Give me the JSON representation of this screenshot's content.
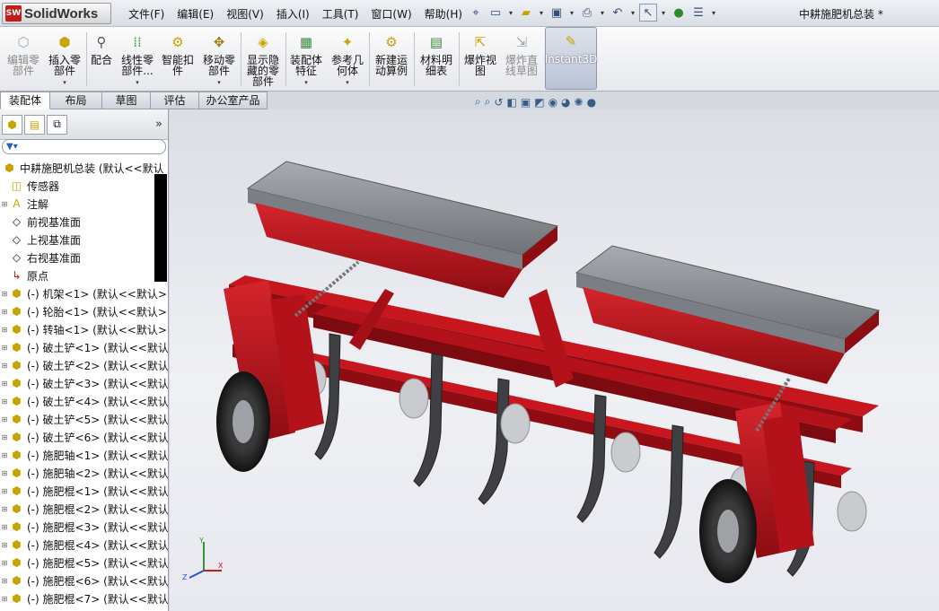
{
  "app": {
    "name": "SolidWorks",
    "logo_mark": "SW"
  },
  "menu": [
    "文件(F)",
    "编辑(E)",
    "视图(V)",
    "插入(I)",
    "工具(T)",
    "窗口(W)",
    "帮助(H)"
  ],
  "quick_toolbar": [
    "pin-icon",
    "new-doc-icon",
    "open-icon",
    "save-icon",
    "print-icon",
    "undo-icon",
    "select-icon",
    "rebuild-icon",
    "options-icon"
  ],
  "document_title": "中耕施肥机总装 *",
  "command_manager": {
    "buttons": [
      {
        "label": "编辑零\n部件",
        "icon": "edit-component-icon",
        "disabled": true
      },
      {
        "label": "插入零\n部件",
        "icon": "insert-component-icon",
        "disabled": false
      },
      {
        "label": "配合",
        "icon": "mate-icon",
        "disabled": false
      },
      {
        "label": "线性零\n部件...",
        "icon": "linear-pattern-icon",
        "disabled": false
      },
      {
        "label": "智能扣\n件",
        "icon": "smart-fastener-icon",
        "disabled": false
      },
      {
        "label": "移动零\n部件",
        "icon": "move-component-icon",
        "disabled": false
      },
      {
        "label": "显示隐\n藏的零\n部件",
        "icon": "show-hidden-icon",
        "disabled": false
      },
      {
        "label": "装配体\n特征",
        "icon": "assembly-feature-icon",
        "disabled": false
      },
      {
        "label": "参考几\n何体",
        "icon": "reference-geometry-icon",
        "disabled": false
      },
      {
        "label": "新建运\n动算例",
        "icon": "motion-study-icon",
        "disabled": false
      },
      {
        "label": "材料明\n细表",
        "icon": "bom-icon",
        "disabled": false
      },
      {
        "label": "爆炸视\n图",
        "icon": "exploded-view-icon",
        "disabled": false
      },
      {
        "label": "爆炸直\n线草图",
        "icon": "explode-line-icon",
        "disabled": true
      },
      {
        "label": "Instant3D",
        "icon": "instant3d-icon",
        "disabled": false
      }
    ]
  },
  "tabs": [
    "装配体",
    "布局",
    "草图",
    "评估",
    "办公室产品"
  ],
  "feature_tree": {
    "root": "中耕施肥机总装  (默认<<默认",
    "items": [
      {
        "label": "传感器",
        "icon": "sensor-icon"
      },
      {
        "label": "注解",
        "icon": "annotation-icon"
      },
      {
        "label": "前视基准面",
        "icon": "plane-icon"
      },
      {
        "label": "上视基准面",
        "icon": "plane-icon"
      },
      {
        "label": "右视基准面",
        "icon": "plane-icon"
      },
      {
        "label": "原点",
        "icon": "origin-icon"
      },
      {
        "label": "(-) 机架<1> (默认<<默认>",
        "icon": "part-icon"
      },
      {
        "label": "(-) 轮胎<1> (默认<<默认>",
        "icon": "part-icon"
      },
      {
        "label": "(-) 转轴<1> (默认<<默认>",
        "icon": "part-icon"
      },
      {
        "label": "(-) 破土铲<1> (默认<<默认",
        "icon": "part-icon"
      },
      {
        "label": "(-) 破土铲<2> (默认<<默认",
        "icon": "part-icon"
      },
      {
        "label": "(-) 破土铲<3> (默认<<默认",
        "icon": "part-icon"
      },
      {
        "label": "(-) 破土铲<4> (默认<<默认",
        "icon": "part-icon"
      },
      {
        "label": "(-) 破土铲<5> (默认<<默认",
        "icon": "part-icon"
      },
      {
        "label": "(-) 破土铲<6> (默认<<默认",
        "icon": "part-icon"
      },
      {
        "label": "(-) 施肥轴<1> (默认<<默认",
        "icon": "part-icon"
      },
      {
        "label": "(-) 施肥轴<2> (默认<<默认",
        "icon": "part-icon"
      },
      {
        "label": "(-) 施肥棍<1> (默认<<默认",
        "icon": "part-icon"
      },
      {
        "label": "(-) 施肥棍<2> (默认<<默认",
        "icon": "part-icon"
      },
      {
        "label": "(-) 施肥棍<3> (默认<<默认",
        "icon": "part-icon"
      },
      {
        "label": "(-) 施肥棍<4> (默认<<默认",
        "icon": "part-icon"
      },
      {
        "label": "(-) 施肥棍<5> (默认<<默认",
        "icon": "part-icon"
      },
      {
        "label": "(-) 施肥棍<6> (默认<<默认",
        "icon": "part-icon"
      },
      {
        "label": "(-) 施肥棍<7> (默认<<默认",
        "icon": "part-icon"
      }
    ]
  },
  "triad": {
    "x": "X",
    "y": "Y",
    "z": "Z"
  },
  "colors": {
    "frame_red": "#b3121a",
    "hopper_grey": "#8b8f95",
    "tyre_black": "#1e1e1e"
  }
}
